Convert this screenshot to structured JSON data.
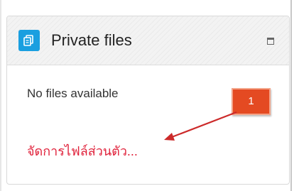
{
  "block": {
    "title": "Private files",
    "icon": "files-icon",
    "collapse_icon": "collapse-minus-icon",
    "empty_message": "No files available",
    "manage_link": "จัดการไฟล์ส่วนตัว..."
  },
  "annotation": {
    "number": "1",
    "color": "#e44a22",
    "arrow_color": "#cc2a2a"
  },
  "colors": {
    "icon_bg": "#1a9fe0",
    "link": "#e0223b"
  }
}
